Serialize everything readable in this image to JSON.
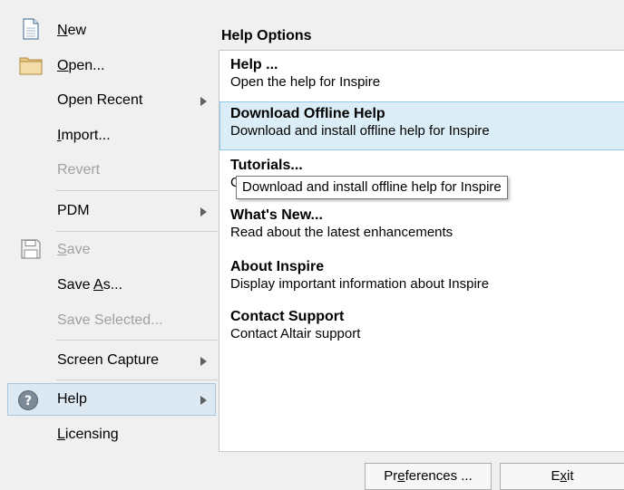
{
  "menu": {
    "new": {
      "label_u": "N",
      "label_rest": "ew"
    },
    "open": {
      "label_u": "O",
      "label_rest": "pen..."
    },
    "open_recent": {
      "label": "Open Recent"
    },
    "import": {
      "label_u": "I",
      "label_rest": "mport..."
    },
    "revert": {
      "label": "Revert"
    },
    "pdm": {
      "label": "PDM"
    },
    "save": {
      "label_u": "S",
      "label_rest": "ave"
    },
    "save_as": {
      "label_pre": "Save ",
      "label_u": "A",
      "label_rest": "s..."
    },
    "save_selected": {
      "label": "Save Selected..."
    },
    "screen_capture": {
      "label": "Screen Capture"
    },
    "help": {
      "label": "Help"
    },
    "licensing": {
      "label_u": "L",
      "label_rest": "icensing"
    }
  },
  "panel": {
    "title": "Help Options",
    "options": [
      {
        "title": "Help ...",
        "desc": "Open the help for Inspire"
      },
      {
        "title": "Download Offline Help",
        "desc": "Download and install offline help for Inspire"
      },
      {
        "title": "Tutorials...",
        "desc": "C"
      },
      {
        "title": "What's New...",
        "desc": "Read about the latest enhancements"
      },
      {
        "title": "About Inspire",
        "desc": "Display important information about Inspire"
      },
      {
        "title": "Contact Support",
        "desc": "Contact Altair support"
      }
    ]
  },
  "tooltip": {
    "text": "Download and install offline help for Inspire"
  },
  "buttons": {
    "preferences": {
      "pre": "Pr",
      "u": "e",
      "rest": "ferences ..."
    },
    "exit": {
      "pre": "E",
      "u": "x",
      "rest": "it"
    }
  },
  "colors": {
    "selection": "#dbeef8",
    "highlight": "#dde9f2",
    "disabled_text": "#a0a0a0"
  }
}
